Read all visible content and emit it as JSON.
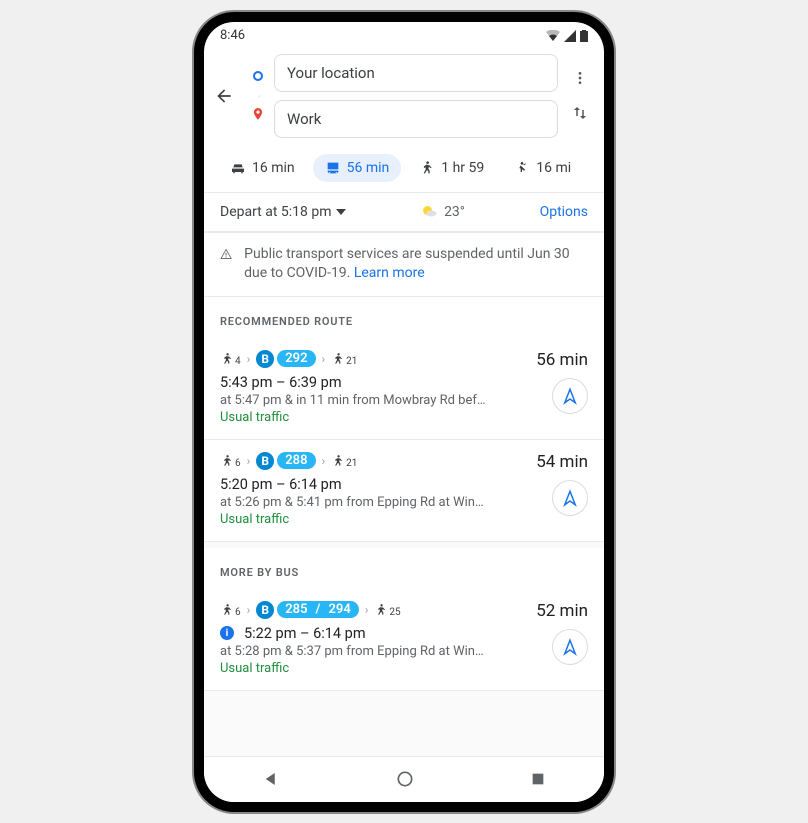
{
  "status": {
    "time": "8:46"
  },
  "header": {
    "origin_value": "Your location",
    "dest_value": "Work"
  },
  "modes": {
    "drive": "16 min",
    "transit": "56 min",
    "walk": "1 hr 59",
    "ride": "16 mi"
  },
  "depart_row": {
    "depart_label": "Depart at 5:18 pm",
    "temp": "23°",
    "options": "Options"
  },
  "alert": {
    "text": "Public transport services are suspended until Jun 30 due to COVID-19. ",
    "link": "Learn more"
  },
  "sections": {
    "recommended": "RECOMMENDED ROUTE",
    "more_bus": "MORE BY BUS"
  },
  "routes": [
    {
      "walk1": "4",
      "bus_letter": "B",
      "bus_num": "292",
      "walk2": "21",
      "duration": "56 min",
      "time_range": "5:43 pm – 6:39 pm",
      "detail": "at 5:47 pm & in 11 min from Mowbray Rd bef…",
      "traffic": "Usual traffic"
    },
    {
      "walk1": "6",
      "bus_letter": "B",
      "bus_num": "288",
      "walk2": "21",
      "duration": "54 min",
      "time_range": "5:20 pm – 6:14 pm",
      "detail": "at 5:26 pm & 5:41 pm from Epping Rd at Win…",
      "traffic": "Usual traffic"
    }
  ],
  "more_routes": [
    {
      "walk1": "6",
      "bus_letter": "B",
      "bus_nums": [
        "285",
        "294"
      ],
      "walk2": "25",
      "duration": "52 min",
      "time_range": "5:22 pm – 6:14 pm",
      "detail": "at 5:28 pm & 5:37 pm from Epping Rd at Win…",
      "traffic": "Usual traffic",
      "info": true
    }
  ]
}
